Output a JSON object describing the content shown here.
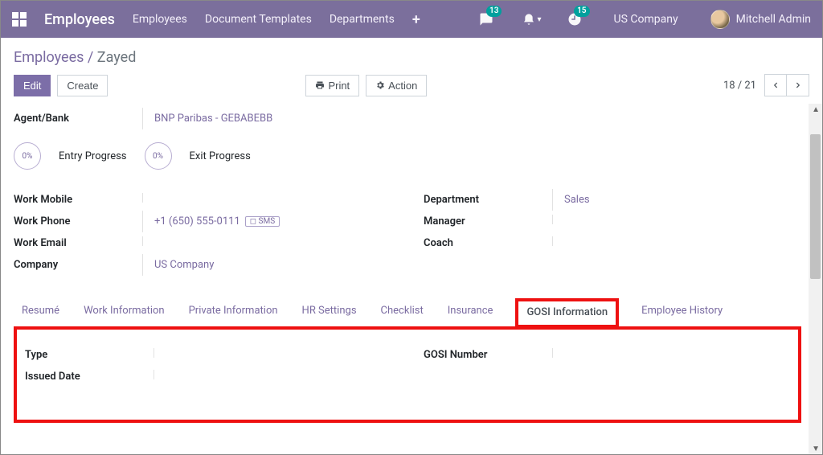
{
  "nav": {
    "brand": "Employees",
    "items": [
      "Employees",
      "Document Templates",
      "Departments"
    ],
    "messaging_badge": "13",
    "activity_badge": "15",
    "company": "US Company",
    "user": "Mitchell Admin"
  },
  "breadcrumb": {
    "root": "Employees",
    "current": "Zayed"
  },
  "actions": {
    "edit": "Edit",
    "create": "Create",
    "print": "Print",
    "action": "Action",
    "pager": "18 / 21"
  },
  "form": {
    "agent_bank_label": "Agent/Bank",
    "agent_bank_value": "BNP Paribas - GEBABEBB",
    "entry_pct": "0%",
    "entry_label": "Entry Progress",
    "exit_pct": "0%",
    "exit_label": "Exit Progress",
    "left": {
      "work_mobile_label": "Work Mobile",
      "work_mobile_value": "",
      "work_phone_label": "Work Phone",
      "work_phone_value": "+1 (650) 555-0111",
      "sms": "SMS",
      "work_email_label": "Work Email",
      "work_email_value": "",
      "company_label": "Company",
      "company_value": "US Company"
    },
    "right": {
      "department_label": "Department",
      "department_value": "Sales",
      "manager_label": "Manager",
      "manager_value": "",
      "coach_label": "Coach",
      "coach_value": ""
    }
  },
  "tabs": {
    "items": [
      "Resumé",
      "Work Information",
      "Private Information",
      "HR Settings",
      "Checklist",
      "Insurance",
      "GOSI Information",
      "Employee History"
    ],
    "active": "GOSI Information"
  },
  "gosi": {
    "type_label": "Type",
    "type_value": "",
    "issued_label": "Issued Date",
    "issued_value": "",
    "number_label": "GOSI Number",
    "number_value": ""
  }
}
